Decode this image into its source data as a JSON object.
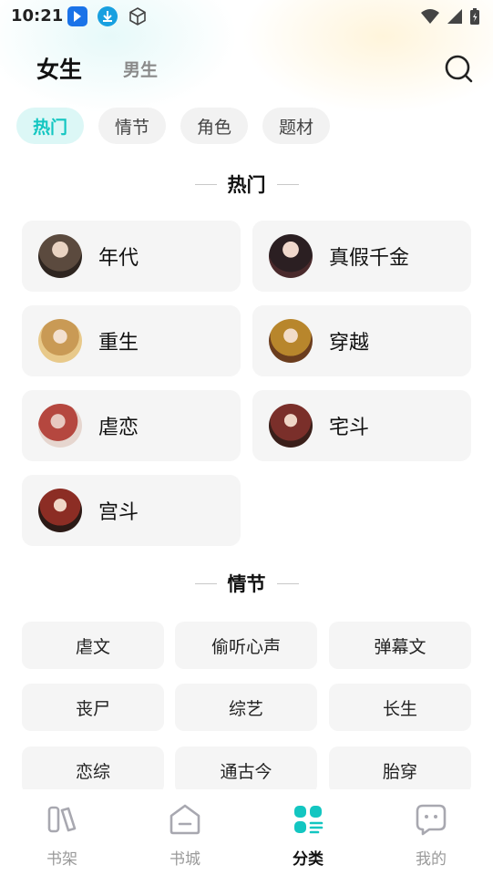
{
  "status_bar": {
    "time": "10:21"
  },
  "header": {
    "tabs": [
      {
        "label": "女生",
        "active": true
      },
      {
        "label": "男生",
        "active": false
      }
    ]
  },
  "chips": [
    {
      "label": "热门",
      "active": true
    },
    {
      "label": "情节",
      "active": false
    },
    {
      "label": "角色",
      "active": false
    },
    {
      "label": "题材",
      "active": false
    }
  ],
  "hot_section": {
    "title": "热门",
    "items": [
      {
        "label": "年代",
        "avatar_color": "#5b4a3e"
      },
      {
        "label": "真假千金",
        "avatar_color": "#2b1f22"
      },
      {
        "label": "重生",
        "avatar_color": "#c99a55"
      },
      {
        "label": "穿越",
        "avatar_color": "#b8862c"
      },
      {
        "label": "虐恋",
        "avatar_color": "#b5473f"
      },
      {
        "label": "宅斗",
        "avatar_color": "#7a2f2a"
      },
      {
        "label": "宫斗",
        "avatar_color": "#8c2d24"
      }
    ]
  },
  "plot_section": {
    "title": "情节",
    "items": [
      "虐文",
      "偷听心声",
      "弹幕文",
      "丧尸",
      "综艺",
      "长生",
      "恋综",
      "通古今",
      "胎穿"
    ]
  },
  "bottom_nav": {
    "items": [
      {
        "label": "书架",
        "icon": "bookshelf-icon",
        "active": false
      },
      {
        "label": "书城",
        "icon": "bookstore-icon",
        "active": false
      },
      {
        "label": "分类",
        "icon": "category-icon",
        "active": true
      },
      {
        "label": "我的",
        "icon": "profile-icon",
        "active": false
      }
    ]
  },
  "colors": {
    "accent": "#13c6c1",
    "chip_active_bg": "#dcf7f6",
    "card_bg": "#f5f5f5"
  }
}
